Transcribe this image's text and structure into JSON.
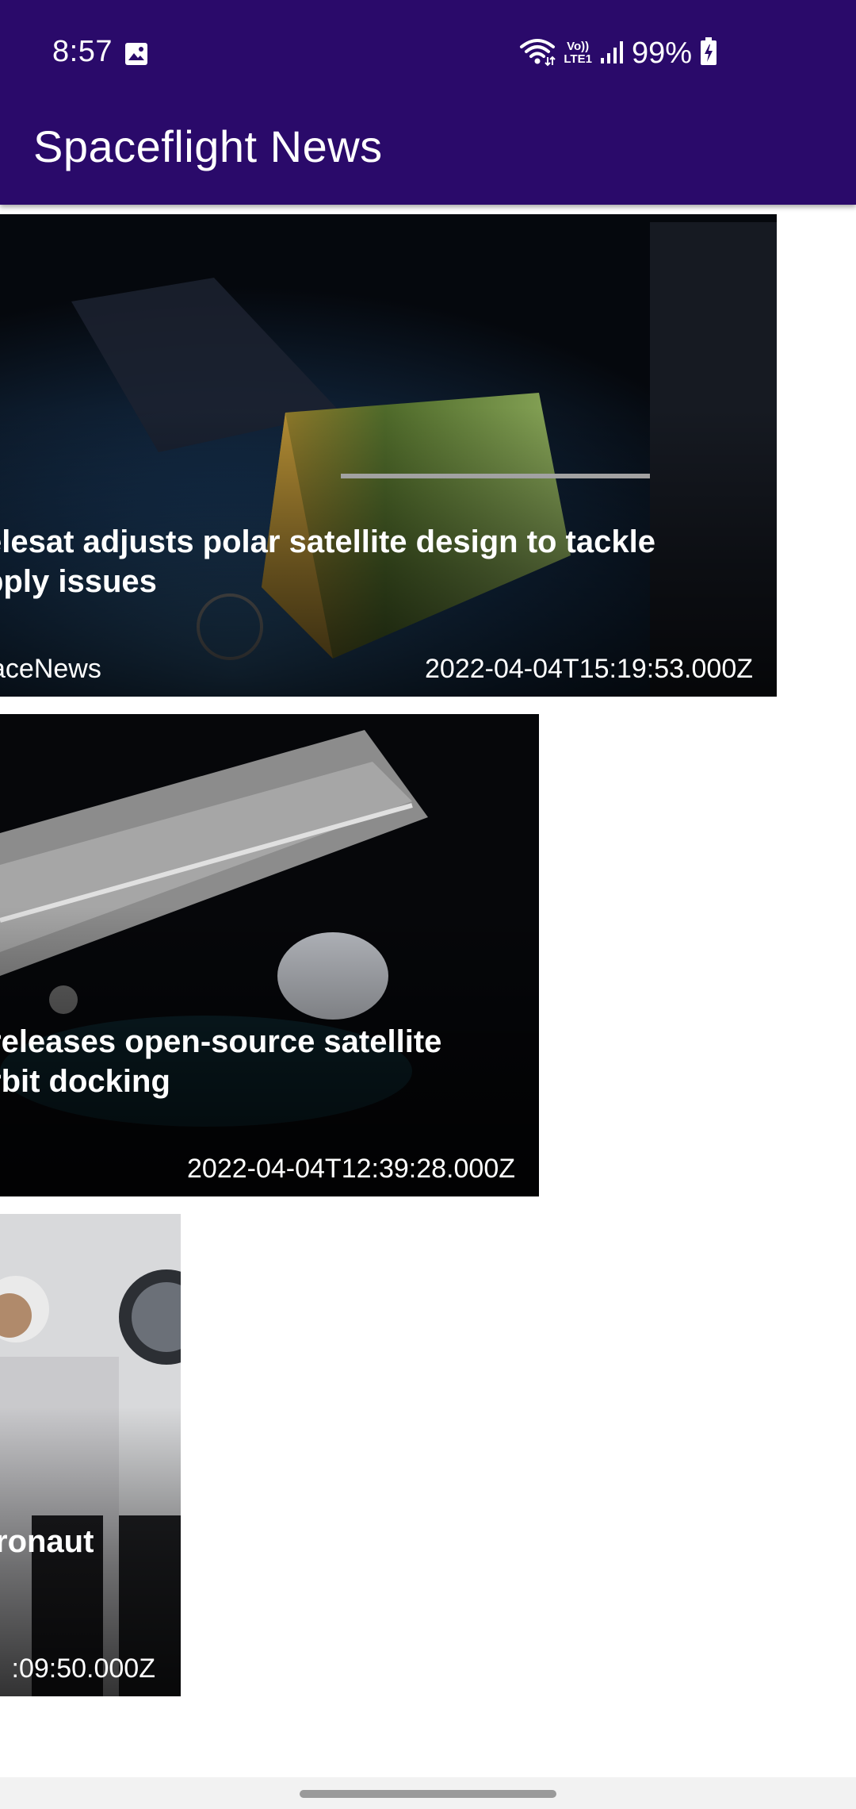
{
  "status_bar": {
    "time": "8:57",
    "gallery_icon": "image-icon",
    "wifi_icon": "wifi-icon",
    "volte_label_top": "Vo))",
    "volte_label_bottom": "LTE1",
    "signal_icon": "cell-signal-icon",
    "battery_percent": "99%",
    "battery_icon": "battery-charging-icon"
  },
  "app_bar": {
    "title": "Spaceflight News",
    "background_color": "#2a0a6a"
  },
  "articles": [
    {
      "title": "elesat adjusts polar satellite design to tackle pply issues",
      "source": "aceNews",
      "published": "2022-04-04T15:19:53.000Z"
    },
    {
      "title": "releases open-source satellite rbit docking",
      "source": "",
      "published": "2022-04-04T12:39:28.000Z"
    },
    {
      "title": "ronaut",
      "source": "",
      "published": ":09:50.000Z"
    }
  ]
}
